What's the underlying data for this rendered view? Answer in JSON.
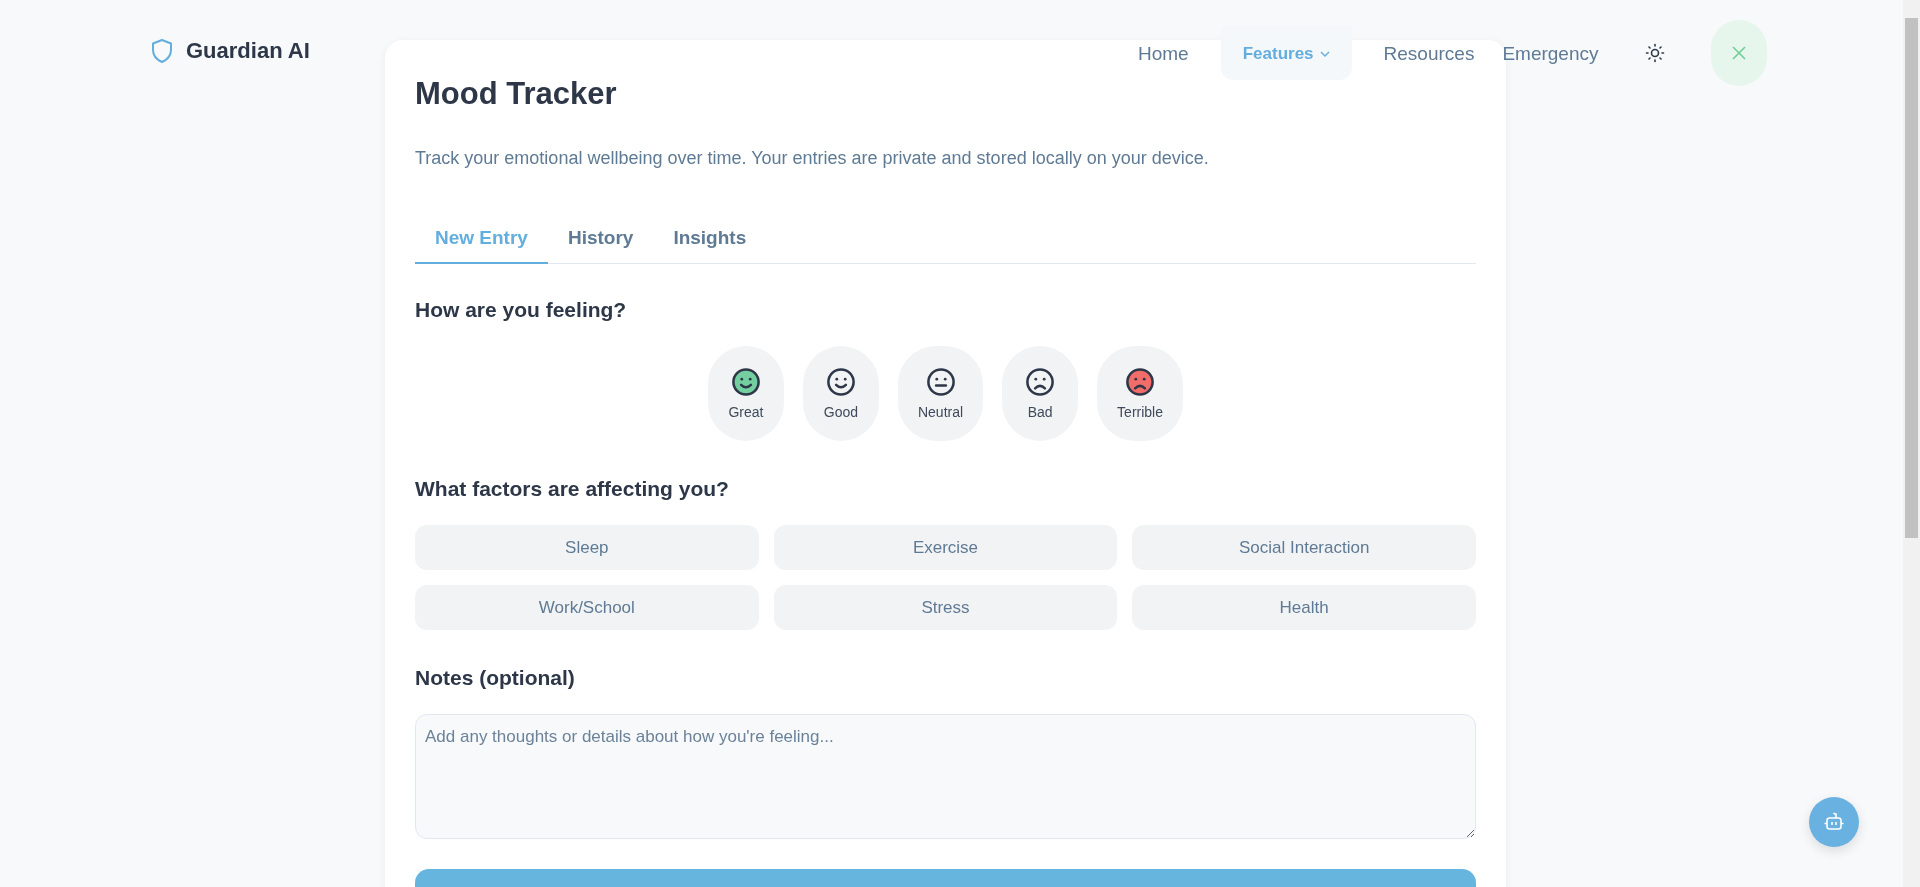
{
  "brand": {
    "name": "Guardian AI"
  },
  "nav": {
    "items": [
      {
        "label": "Home",
        "selected": false,
        "has_menu": false
      },
      {
        "label": "Features",
        "selected": true,
        "has_menu": true
      },
      {
        "label": "Resources",
        "selected": false,
        "has_menu": false
      },
      {
        "label": "Emergency",
        "selected": false,
        "has_menu": false
      }
    ]
  },
  "card": {
    "title": "Mood Tracker",
    "description": "Track your emotional wellbeing over time. Your entries are private and stored locally on your device.",
    "tabs": [
      {
        "label": "New Entry",
        "selected": true
      },
      {
        "label": "History",
        "selected": false
      },
      {
        "label": "Insights",
        "selected": false
      }
    ],
    "mood_heading": "How are you feeling?",
    "moods": [
      {
        "label": "Great",
        "kind": "happy",
        "color": "#74cfa0",
        "selected": false
      },
      {
        "label": "Good",
        "kind": "happy",
        "selected": false
      },
      {
        "label": "Neutral",
        "kind": "neutral",
        "selected": false
      },
      {
        "label": "Bad",
        "kind": "sad",
        "selected": false
      },
      {
        "label": "Terrible",
        "kind": "sad",
        "color": "#f26d6a",
        "selected": false
      }
    ],
    "factors_heading": "What factors are affecting you?",
    "factors": [
      {
        "label": "Sleep",
        "selected": false
      },
      {
        "label": "Exercise",
        "selected": false
      },
      {
        "label": "Social Interaction",
        "selected": false
      },
      {
        "label": "Work/School",
        "selected": false
      },
      {
        "label": "Stress",
        "selected": false
      },
      {
        "label": "Health",
        "selected": false
      }
    ],
    "notes_heading": "Notes (optional)",
    "notes": {
      "placeholder": "Add any thoughts or details about how you're feeling..."
    }
  }
}
